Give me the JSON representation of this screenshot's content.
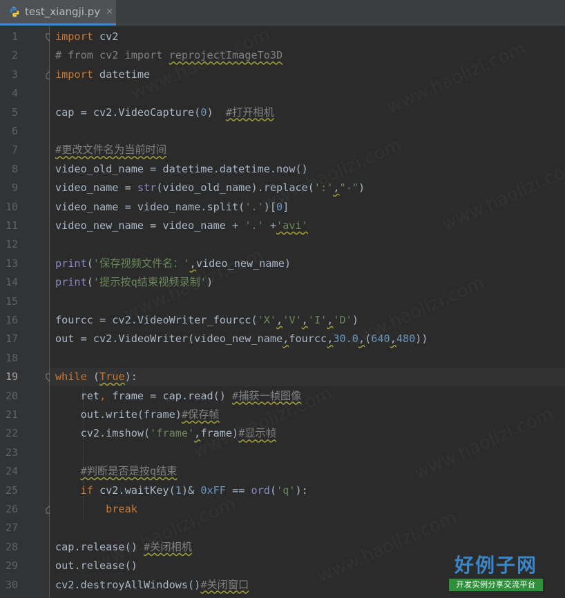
{
  "tab": {
    "filename": "test_xiangji.py",
    "close_glyph": "✕",
    "icon": "python-file-icon"
  },
  "watermark": "www.haolizi.com",
  "logo": {
    "title": "好例子网",
    "subtitle": "开发实例分享交流平台"
  },
  "current_line": 19,
  "colors": {
    "keyword": "#cc7832",
    "number": "#6897bb",
    "string": "#6a8759",
    "comment": "#808080",
    "builtin": "#8888c6",
    "text": "#a9b7c6",
    "background": "#2b2b2b",
    "gutter": "#313335"
  },
  "lines": [
    [
      [
        "kw",
        "import"
      ],
      [
        "t",
        " cv2"
      ]
    ],
    [
      [
        "cmt",
        "# from cv2 import "
      ],
      [
        "cmtw",
        "reprojectImageTo3D"
      ]
    ],
    [
      [
        "kw",
        "import"
      ],
      [
        "t",
        " datetime"
      ]
    ],
    [],
    [
      [
        "t",
        "cap = cv2.VideoCapture("
      ],
      [
        "num",
        "0"
      ],
      [
        "t",
        ")  "
      ],
      [
        "cmtw",
        "#打开相机"
      ]
    ],
    [],
    [
      [
        "cmtw",
        "#更改文件名为当前时间"
      ]
    ],
    [
      [
        "t",
        "video_old_name = datetime.datetime.now()"
      ]
    ],
    [
      [
        "t",
        "video_name = "
      ],
      [
        "bi",
        "str"
      ],
      [
        "t",
        "(video_old_name).replace("
      ],
      [
        "str",
        "':'"
      ],
      [
        "w",
        ","
      ],
      [
        "str",
        "\"-\""
      ],
      [
        "t",
        ")"
      ]
    ],
    [
      [
        "t",
        "video_name = video_name.split("
      ],
      [
        "str",
        "'.'"
      ],
      [
        "t",
        ")["
      ],
      [
        "num",
        "0"
      ],
      [
        "t",
        "]"
      ]
    ],
    [
      [
        "t",
        "video_new_name = video_name + "
      ],
      [
        "str",
        "'.'"
      ],
      [
        "t",
        " +"
      ],
      [
        "strw",
        "'avi'"
      ]
    ],
    [],
    [
      [
        "bi",
        "print"
      ],
      [
        "t",
        "("
      ],
      [
        "str",
        "'保存视频文件名：'"
      ],
      [
        "w",
        ","
      ],
      [
        "t",
        "video_new_name)"
      ]
    ],
    [
      [
        "bi",
        "print"
      ],
      [
        "t",
        "("
      ],
      [
        "str",
        "'提示按q结束视频录制'"
      ],
      [
        "t",
        ")"
      ]
    ],
    [],
    [
      [
        "t",
        "fourcc = cv2.VideoWriter_fourcc("
      ],
      [
        "str",
        "'X'"
      ],
      [
        "w",
        ","
      ],
      [
        "str",
        "'V'"
      ],
      [
        "w",
        ","
      ],
      [
        "str",
        "'I'"
      ],
      [
        "w",
        ","
      ],
      [
        "str",
        "'D'"
      ],
      [
        "t",
        ")"
      ]
    ],
    [
      [
        "t",
        "out = cv2.VideoWriter(video_new_name"
      ],
      [
        "w",
        ","
      ],
      [
        "t",
        "fourcc"
      ],
      [
        "w",
        ","
      ],
      [
        "num",
        "30.0"
      ],
      [
        "w",
        ","
      ],
      [
        "t",
        "("
      ],
      [
        "num",
        "640"
      ],
      [
        "w",
        ","
      ],
      [
        "num",
        "480"
      ],
      [
        "t",
        "))"
      ]
    ],
    [],
    [
      [
        "kw",
        "while"
      ],
      [
        "t",
        " ("
      ],
      [
        "kww",
        "True"
      ],
      [
        "t",
        "):"
      ]
    ],
    [
      [
        "t",
        "    ret"
      ],
      [
        "kw",
        ","
      ],
      [
        "t",
        " frame = cap.read() "
      ],
      [
        "cmtw",
        "#捕获一帧图像"
      ]
    ],
    [
      [
        "t",
        "    out.write(frame)"
      ],
      [
        "cmtw",
        "#保存帧"
      ]
    ],
    [
      [
        "t",
        "    cv2.imshow("
      ],
      [
        "str",
        "'frame'"
      ],
      [
        "w",
        ","
      ],
      [
        "t",
        "frame)"
      ],
      [
        "cmtw",
        "#显示帧"
      ]
    ],
    [],
    [
      [
        "t",
        "    "
      ],
      [
        "cmtw",
        "#判断是否是按q结束"
      ]
    ],
    [
      [
        "t",
        "    "
      ],
      [
        "kw",
        "if"
      ],
      [
        "t",
        " cv2.waitKey("
      ],
      [
        "num",
        "1"
      ],
      [
        "t",
        ")& "
      ],
      [
        "num",
        "0xFF"
      ],
      [
        "t",
        " == "
      ],
      [
        "bi",
        "ord"
      ],
      [
        "t",
        "("
      ],
      [
        "str",
        "'q'"
      ],
      [
        "t",
        "):"
      ]
    ],
    [
      [
        "t",
        "        "
      ],
      [
        "kw",
        "break"
      ]
    ],
    [],
    [
      [
        "t",
        "cap.release() "
      ],
      [
        "cmtw",
        "#关闭相机"
      ]
    ],
    [
      [
        "t",
        "out.release()"
      ]
    ],
    [
      [
        "t",
        "cv2.destroyAllWindows()"
      ],
      [
        "cmtw",
        "#关闭窗口"
      ]
    ]
  ]
}
